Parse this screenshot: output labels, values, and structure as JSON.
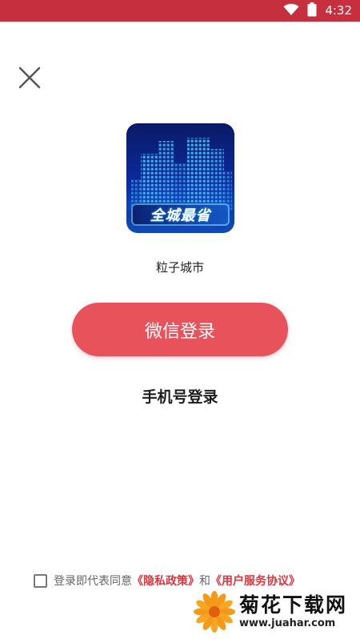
{
  "status_bar": {
    "time": "4:32",
    "icons": [
      "wifi-icon",
      "battery-icon"
    ],
    "color": "#c6303e"
  },
  "close": {
    "icon": "close-icon"
  },
  "logo": {
    "text": "全城最省"
  },
  "app": {
    "name": "粒子城市"
  },
  "login": {
    "wechat_label": "微信登录",
    "wechat_color": "#e8535b",
    "phone_label": "手机号登录"
  },
  "agreement": {
    "prefix": "登录即代表同意",
    "privacy_link": "《隐私政策》",
    "conjunction": "和",
    "terms_link": "《用户服务协议》",
    "checked": false,
    "link_color": "#d9363e"
  },
  "watermark": {
    "title": "菊花下载网",
    "url": "www.juahar.com"
  }
}
